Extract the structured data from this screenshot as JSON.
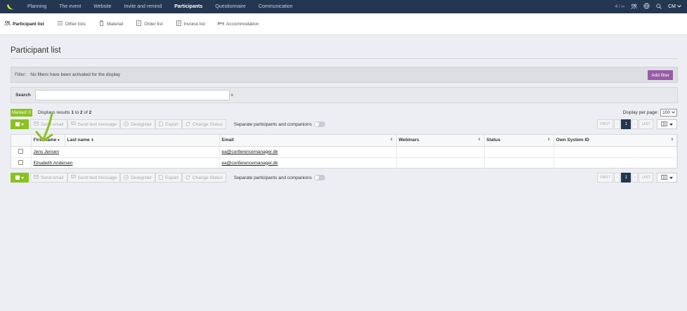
{
  "topnav": {
    "items": [
      {
        "label": "Planning"
      },
      {
        "label": "The event"
      },
      {
        "label": "Website"
      },
      {
        "label": "Invite and remind"
      },
      {
        "label": "Participants",
        "active": true
      },
      {
        "label": "Questionnaire"
      },
      {
        "label": "Communication"
      }
    ],
    "counter": "4 / ∞",
    "user_initials": "CM",
    "icons": [
      "logo-banana",
      "users-icon",
      "globe-icon",
      "search-icon",
      "chevron-down-icon"
    ]
  },
  "subnav": {
    "items": [
      {
        "label": "Participant list",
        "icon": "participants-icon",
        "active": true
      },
      {
        "label": "Other lists",
        "icon": "list-icon"
      },
      {
        "label": "Material",
        "icon": "material-icon"
      },
      {
        "label": "Order list",
        "icon": "order-icon"
      },
      {
        "label": "Invoice list",
        "icon": "invoice-icon"
      },
      {
        "label": "Accommodation",
        "icon": "bed-icon"
      }
    ]
  },
  "page": {
    "title": "Participant list"
  },
  "filter": {
    "label": "Filter:",
    "text": "No filters have been activated for the display",
    "add_button": "Add filter"
  },
  "search": {
    "label": "Search",
    "value": "",
    "placeholder": "",
    "clear_symbol": "×"
  },
  "summary": {
    "marked_label": "Marked: 0",
    "results_prefix": "Displays results ",
    "from": "1",
    "to_word": " to ",
    "to": "2",
    "of_word": " of ",
    "total": "2",
    "per_page_label": "Display per page:",
    "per_page_value": "100"
  },
  "toolbar": {
    "send_email": "Send email",
    "send_text": "Send text message",
    "deregister": "Deregister",
    "export": "Export",
    "change_status": "Change Status",
    "separate_label": "Separate participants and companions",
    "separate_on": false
  },
  "pager": {
    "first": "FIRST",
    "prev": "‹",
    "current": "1",
    "next": "›",
    "last": "LAST"
  },
  "table": {
    "columns": {
      "first_name": "First name",
      "last_name": "Last name",
      "email": "Email",
      "webinars": "Webinars",
      "status": "Status",
      "own_system_id": "Own System ID"
    },
    "rows": [
      {
        "name": "Jens Jensen",
        "email": "ea@conferencemanager.dk",
        "webinars": "",
        "status": "",
        "own_id": ""
      },
      {
        "name": "Elisabeth Andersen",
        "email": "ea@conferencemanager.dk",
        "webinars": "",
        "status": "",
        "own_id": ""
      }
    ]
  },
  "annotation": {
    "arrow_color": "#8cc21f"
  }
}
